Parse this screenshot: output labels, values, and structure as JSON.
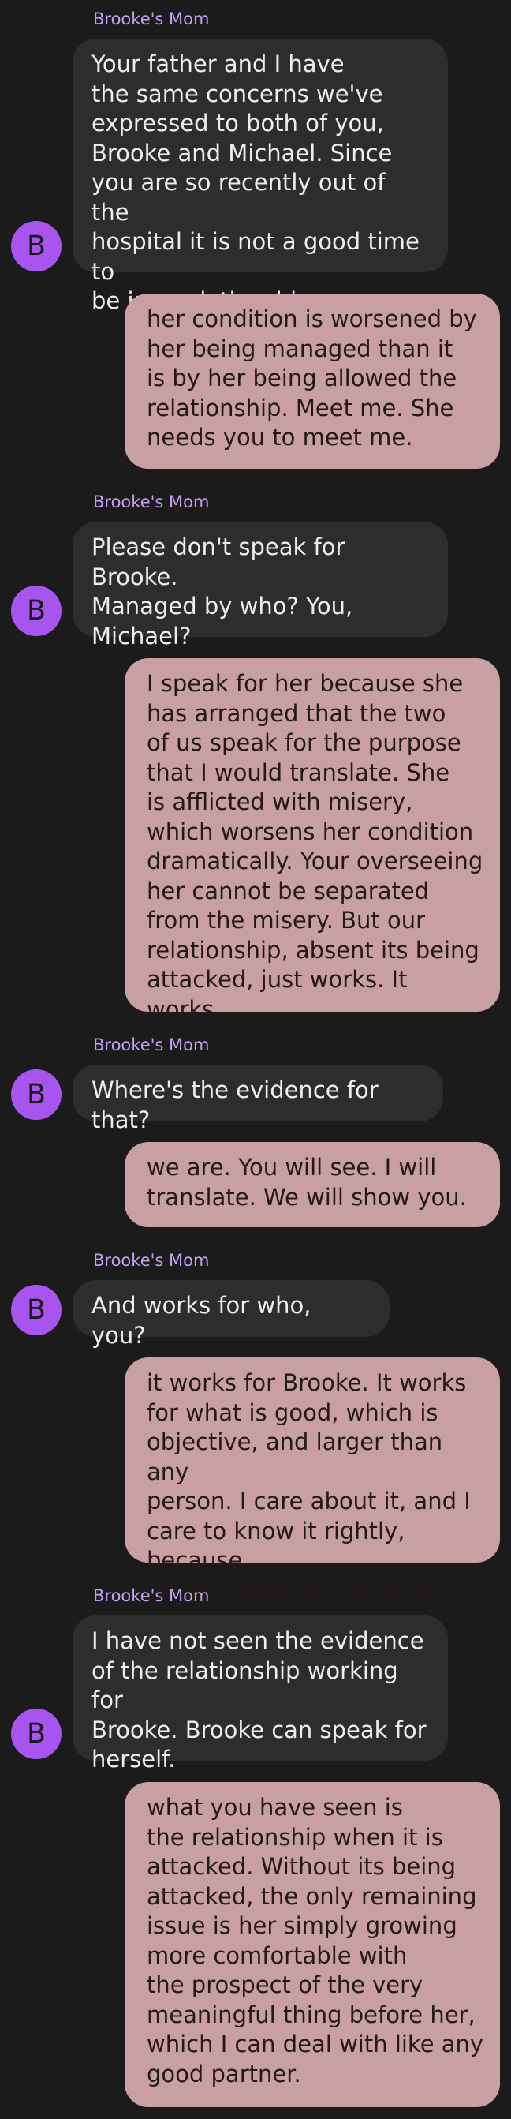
{
  "conversation": {
    "sender_name": "Brooke's Mom",
    "avatar_letter": "B",
    "colors": {
      "background": "#1b1b1b",
      "incoming_bubble": "#2d2d2d",
      "outgoing_bubble": "#c8a0a1",
      "sender_name": "#c99df2",
      "avatar": "#a855f0"
    },
    "messages": [
      {
        "direction": "incoming",
        "text": "Your father and I have\nthe same concerns we've\nexpressed to both of you,\nBrooke and Michael. Since\nyou are so recently out of the\nhospital it is not a good time to\nbe in a relationship."
      },
      {
        "direction": "outgoing",
        "text": "her condition is worsened by\nher being managed than it\nis by her being allowed the\nrelationship. Meet me. She\nneeds you to meet me."
      },
      {
        "direction": "incoming",
        "text": "Please don't speak for Brooke.\nManaged by who? You,\nMichael?"
      },
      {
        "direction": "outgoing",
        "text": "I speak for her because she\nhas arranged that the two\nof us speak for the purpose\nthat I would translate. She\nis afflicted with misery,\nwhich worsens her condition\ndramatically. Your overseeing\nher cannot be separated\nfrom the misery. But our\nrelationship, absent its being\nattacked, just works. It works."
      },
      {
        "direction": "incoming",
        "text": "Where's the evidence for that?"
      },
      {
        "direction": "outgoing",
        "text": "we are. You will see. I will\ntranslate. We will show you."
      },
      {
        "direction": "incoming",
        "text": "And works for who, you?"
      },
      {
        "direction": "outgoing",
        "text": "it works for Brooke. It works\nfor what is good, which is\nobjective, and larger than any\nperson. I care about it, and I\ncare to know it rightly, because\nI must, because I love her."
      },
      {
        "direction": "incoming",
        "text": "I have not seen the evidence\nof the relationship working for\nBrooke. Brooke can speak for\nherself."
      },
      {
        "direction": "outgoing",
        "text": "what you have seen is\nthe relationship when it is\nattacked. Without its being\nattacked, the only remaining\nissue is her simply growing\nmore comfortable with\nthe prospect of the very\nmeaningful thing before her,\nwhich I can deal with like any\ngood partner."
      }
    ]
  }
}
